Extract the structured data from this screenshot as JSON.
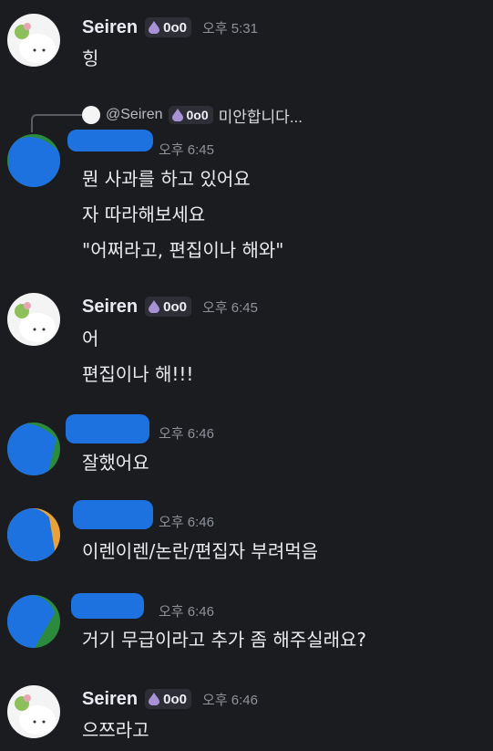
{
  "messages": [
    {
      "author": "Seiren",
      "badge": "0o0",
      "time": "오후 5:31",
      "lines": [
        "힝"
      ]
    },
    {
      "reply": {
        "mention": "@Seiren",
        "badge": "0o0",
        "snippet": "미안합니다..."
      },
      "author": "",
      "time": "오후 6:45",
      "lines": [
        "뭔 사과를 하고 있어요",
        "자 따라해보세요",
        "\"어쩌라고, 편집이나 해와\""
      ]
    },
    {
      "author": "Seiren",
      "badge": "0o0",
      "time": "오후 6:45",
      "lines": [
        "어",
        "편집이나 해!!!"
      ]
    },
    {
      "author": "",
      "time": "오후 6:46",
      "lines": [
        "잘했어요"
      ]
    },
    {
      "author": "",
      "time": "오후 6:46",
      "lines": [
        "이렌이렌/논란/편집자 부려먹음"
      ]
    },
    {
      "author": "",
      "time": "오후 6:46",
      "lines": [
        "거기 무급이라고 추가 좀 해주실래요?"
      ]
    },
    {
      "author": "Seiren",
      "badge": "0o0",
      "time": "오후 6:46",
      "lines": [
        "으쯔라고"
      ]
    }
  ],
  "colors": {
    "background": "#1b1c20",
    "redaction": "#1e72e0",
    "timestamp": "#8f929a"
  },
  "icons": {
    "badge": "purple-drop-icon",
    "seiren_avatar": "seiren-avatar-icon"
  }
}
